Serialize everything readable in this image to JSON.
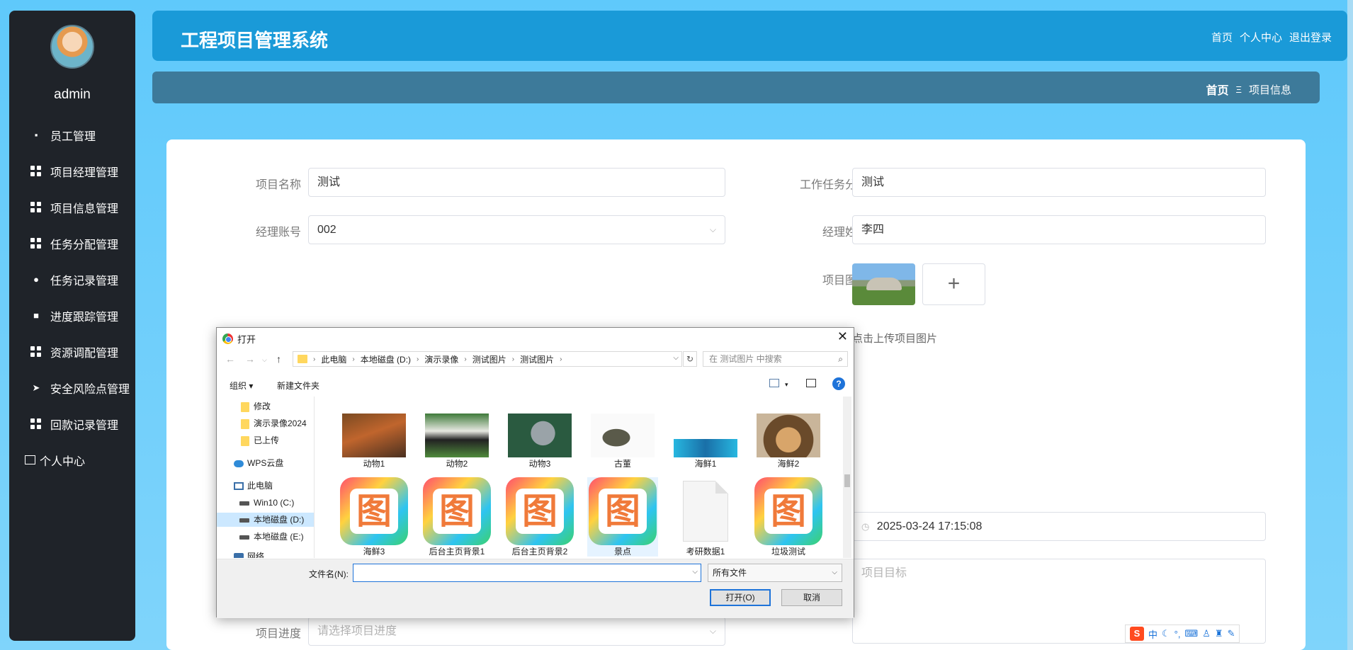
{
  "sidebar": {
    "username": "admin",
    "items": [
      {
        "label": "员工管理",
        "icon": "chat-icon"
      },
      {
        "label": "项目经理管理",
        "icon": "grid-icon"
      },
      {
        "label": "项目信息管理",
        "icon": "grid-icon"
      },
      {
        "label": "任务分配管理",
        "icon": "grid-icon"
      },
      {
        "label": "任务记录管理",
        "icon": "bulb-icon"
      },
      {
        "label": "进度跟踪管理",
        "icon": "clipboard-icon"
      },
      {
        "label": "资源调配管理",
        "icon": "grid-icon"
      },
      {
        "label": "安全风险点管理",
        "icon": "send-icon"
      },
      {
        "label": "回款记录管理",
        "icon": "grid-icon"
      },
      {
        "label": "个人中心",
        "icon": "card-icon"
      }
    ]
  },
  "header": {
    "title": "工程项目管理系统",
    "nav": [
      "首页",
      "个人中心",
      "退出登录"
    ]
  },
  "breadcrumb": {
    "home": "首页",
    "sep": "Ξ",
    "current": "项目信息"
  },
  "form": {
    "project_name_label": "项目名称",
    "project_name_value": "测试",
    "task_assign_label": "工作任务分配",
    "task_assign_value": "测试",
    "manager_account_label": "经理账号",
    "manager_account_value": "002",
    "manager_name_label": "经理姓名",
    "manager_name_value": "李四",
    "project_image_label": "项目图片",
    "upload_hint": "点击上传项目图片",
    "datetime_value": "2025-03-24 17:15:08",
    "goal_placeholder": "项目目标",
    "progress_label": "项目进度",
    "progress_placeholder": "请选择项目进度"
  },
  "dialog": {
    "title": "打开",
    "path": [
      "此电脑",
      "本地磁盘 (D:)",
      "演示录像",
      "测试图片",
      "测试图片"
    ],
    "search_placeholder": "在 测试图片 中搜索",
    "organize": "组织 ▾",
    "new_folder": "新建文件夹",
    "tree": [
      {
        "label": "修改",
        "type": "folder"
      },
      {
        "label": "演示录像2024",
        "type": "folder"
      },
      {
        "label": "已上传",
        "type": "folder"
      },
      {
        "label": "WPS云盘",
        "type": "cloud"
      },
      {
        "label": "此电脑",
        "type": "pc"
      },
      {
        "label": "Win10 (C:)",
        "type": "drive"
      },
      {
        "label": "本地磁盘 (D:)",
        "type": "drive"
      },
      {
        "label": "本地磁盘 (E:)",
        "type": "drive"
      },
      {
        "label": "网络",
        "type": "net"
      }
    ],
    "files_row1": [
      "动物1",
      "动物2",
      "动物3",
      "古董",
      "海鲜1",
      "海鲜2"
    ],
    "files_row2": [
      "海鲜3",
      "后台主页背景1",
      "后台主页背景2",
      "景点",
      "考研数据1",
      "垃圾测试"
    ],
    "filename_label": "文件名(N):",
    "filename_value": "",
    "filter_value": "所有文件",
    "open_button": "打开(O)",
    "cancel_button": "取消"
  },
  "ime": {
    "lang": "中"
  }
}
